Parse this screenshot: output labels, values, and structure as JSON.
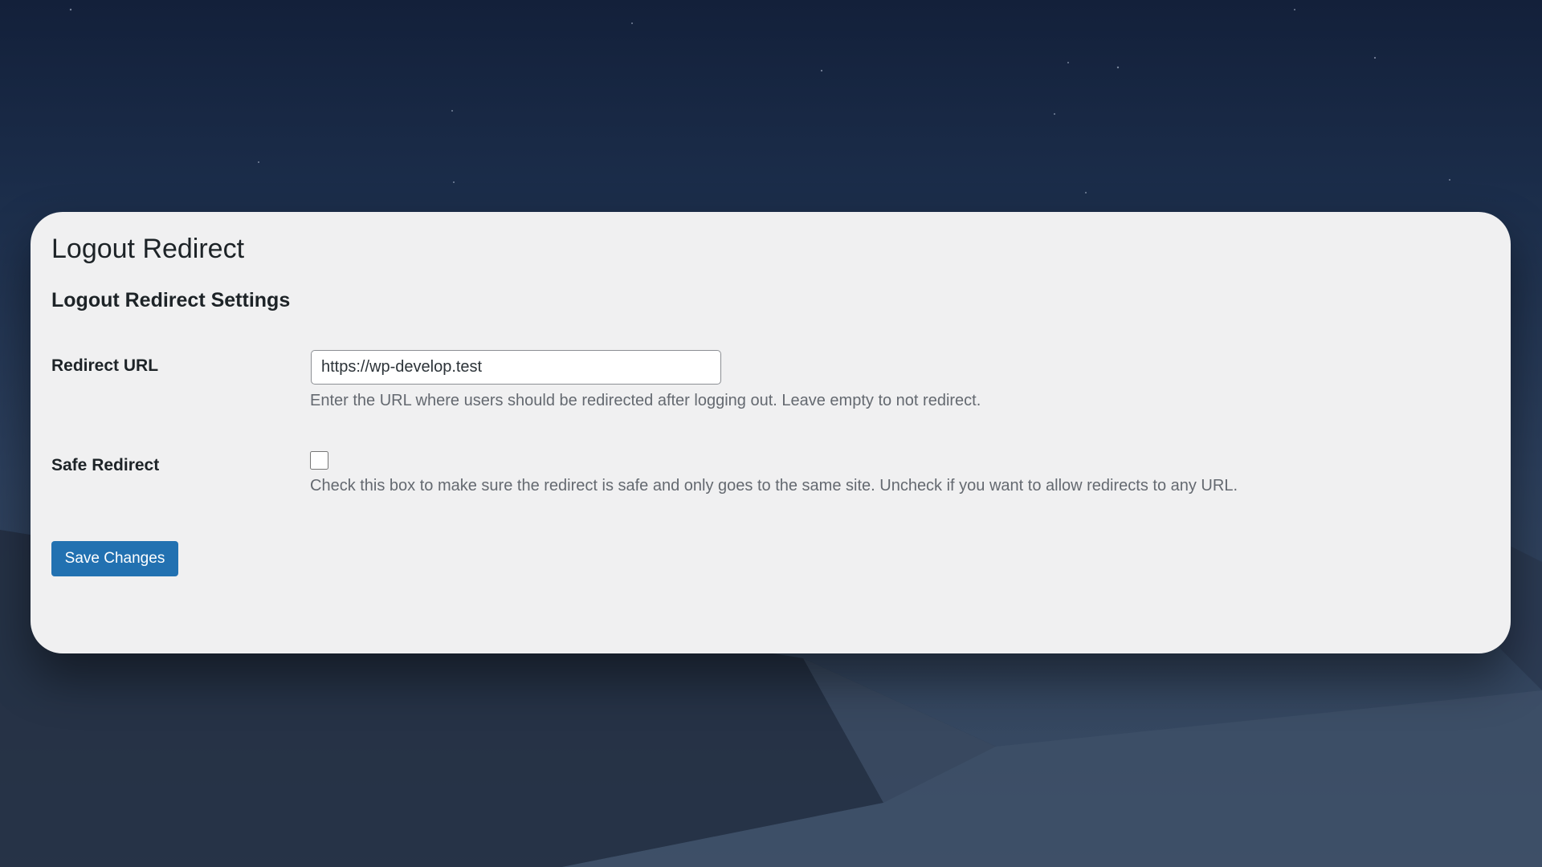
{
  "page": {
    "title": "Logout Redirect"
  },
  "section": {
    "title": "Logout Redirect Settings"
  },
  "redirect_url": {
    "label": "Redirect URL",
    "value": "https://wp-develop.test",
    "description": "Enter the URL where users should be redirected after logging out. Leave empty to not redirect."
  },
  "safe_redirect": {
    "label": "Safe Redirect",
    "checked": false,
    "description": "Check this box to make sure the redirect is safe and only goes to the same site. Uncheck if you want to allow redirects to any URL."
  },
  "actions": {
    "save_label": "Save Changes"
  },
  "colors": {
    "primary_button": "#2271b1",
    "panel_background": "#f0f0f1",
    "text": "#1d2327",
    "description_text": "#646970"
  }
}
